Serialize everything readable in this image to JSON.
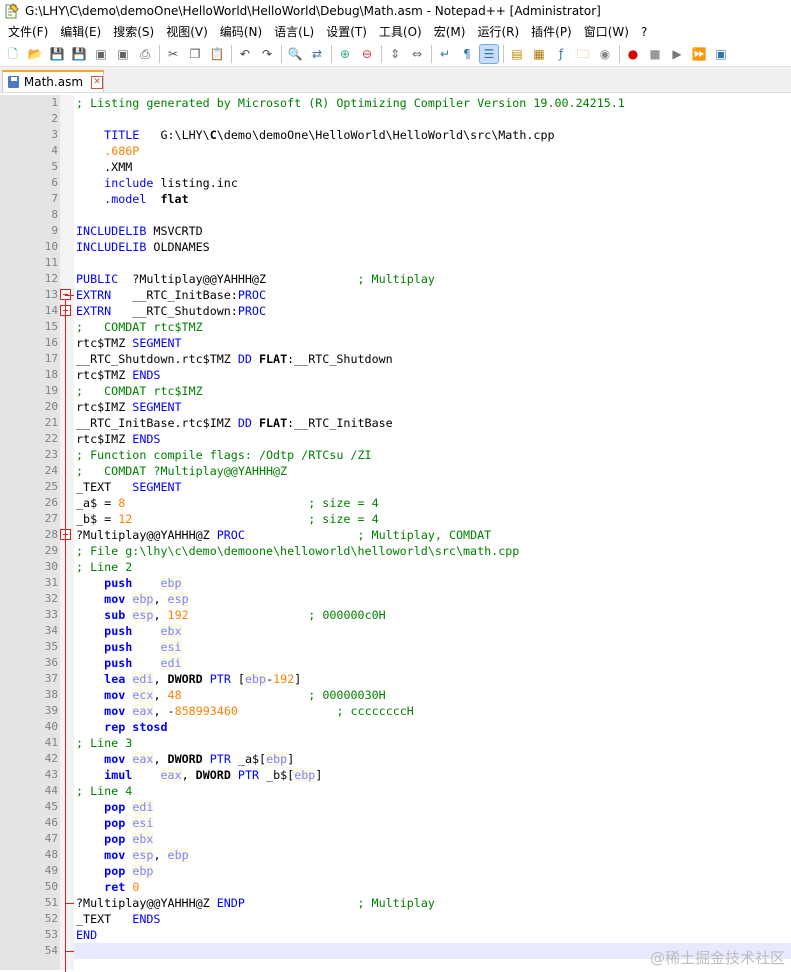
{
  "window": {
    "title": "G:\\LHY\\C\\demo\\demoOne\\HelloWorld\\HelloWorld\\Debug\\Math.asm - Notepad++ [Administrator]"
  },
  "menu": [
    "文件(F)",
    "编辑(E)",
    "搜索(S)",
    "视图(V)",
    "编码(N)",
    "语言(L)",
    "设置(T)",
    "工具(O)",
    "宏(M)",
    "运行(R)",
    "插件(P)",
    "窗口(W)",
    "?"
  ],
  "toolbar_icons": [
    "new-file-icon",
    "open-file-icon",
    "save-icon",
    "save-all-icon",
    "close-icon",
    "close-all-icon",
    "print-icon",
    "|",
    "cut-icon",
    "copy-icon",
    "paste-icon",
    "|",
    "undo-icon",
    "redo-icon",
    "|",
    "find-icon",
    "replace-icon",
    "|",
    "zoom-in-icon",
    "zoom-out-icon",
    "|",
    "sync-v-icon",
    "sync-h-icon",
    "|",
    "word-wrap-icon",
    "show-all-chars-icon",
    "indent-guide-icon",
    "|",
    "udl-icon",
    "doc-map-icon",
    "function-list-icon",
    "folder-as-workspace-icon",
    "monitor-icon",
    "|",
    "record-macro-icon",
    "stop-record-icon",
    "play-macro-icon",
    "run-macro-multiple-icon",
    "save-macro-icon"
  ],
  "tab": {
    "label": "Math.asm"
  },
  "watermark": "@稀土掘金技术社区",
  "current_line": 54,
  "lines": [
    [
      [
        "; Listing generated by Microsoft (R) Optimizing Compiler Version 19.00.24215.1",
        "comment"
      ]
    ],
    [],
    [
      [
        "    ",
        "plain"
      ],
      [
        "TITLE",
        "dir"
      ],
      [
        "   G:\\LHY\\",
        "plain"
      ],
      [
        "C",
        "bold"
      ],
      [
        "\\demo\\demoOne\\HelloWorld\\HelloWorld\\src\\Math.cpp",
        "plain"
      ]
    ],
    [
      [
        "    ",
        "plain"
      ],
      [
        ".686P",
        "num"
      ]
    ],
    [
      [
        "    .XMM",
        "plain"
      ]
    ],
    [
      [
        "    ",
        "plain"
      ],
      [
        "include",
        "dir"
      ],
      [
        " listing.inc",
        "plain"
      ]
    ],
    [
      [
        "    ",
        "plain"
      ],
      [
        ".model",
        "dir"
      ],
      [
        "  ",
        "plain"
      ],
      [
        "flat",
        "bold"
      ]
    ],
    [],
    [
      [
        "INCLUDELIB",
        "dir"
      ],
      [
        " MSVCRTD",
        "plain"
      ]
    ],
    [
      [
        "INCLUDELIB",
        "dir"
      ],
      [
        " OLDNAMES",
        "plain"
      ]
    ],
    [],
    [
      [
        "PUBLIC",
        "dir"
      ],
      [
        "  ?Multiplay@@YAHHH@Z             ",
        "plain"
      ],
      [
        "; Multiplay",
        "comment"
      ]
    ],
    [
      [
        "EXTRN",
        "dir"
      ],
      [
        "   __RTC_InitBase:",
        "plain"
      ],
      [
        "PROC",
        "dir"
      ]
    ],
    [
      [
        "EXTRN",
        "dir"
      ],
      [
        "   __RTC_Shutdown:",
        "plain"
      ],
      [
        "PROC",
        "dir"
      ]
    ],
    [
      [
        ";   COMDAT rtc$TMZ",
        "comment"
      ]
    ],
    [
      [
        "rtc$TMZ ",
        "plain"
      ],
      [
        "SEGMENT",
        "dir"
      ]
    ],
    [
      [
        "__RTC_Shutdown.rtc$TMZ ",
        "plain"
      ],
      [
        "DD",
        "dir"
      ],
      [
        " ",
        "plain"
      ],
      [
        "FLAT",
        "bold"
      ],
      [
        ":__RTC_Shutdown",
        "plain"
      ]
    ],
    [
      [
        "rtc$TMZ ",
        "plain"
      ],
      [
        "ENDS",
        "dir"
      ]
    ],
    [
      [
        ";   COMDAT rtc$IMZ",
        "comment"
      ]
    ],
    [
      [
        "rtc$IMZ ",
        "plain"
      ],
      [
        "SEGMENT",
        "dir"
      ]
    ],
    [
      [
        "__RTC_InitBase.rtc$IMZ ",
        "plain"
      ],
      [
        "DD",
        "dir"
      ],
      [
        " ",
        "plain"
      ],
      [
        "FLAT",
        "bold"
      ],
      [
        ":__RTC_InitBase",
        "plain"
      ]
    ],
    [
      [
        "rtc$IMZ ",
        "plain"
      ],
      [
        "ENDS",
        "dir"
      ]
    ],
    [
      [
        "; Function compile flags: /Odtp /RTCsu /ZI",
        "comment"
      ]
    ],
    [
      [
        ";   COMDAT ?Multiplay@@YAHHH@Z",
        "comment"
      ]
    ],
    [
      [
        "_TEXT   ",
        "plain"
      ],
      [
        "SEGMENT",
        "dir"
      ]
    ],
    [
      [
        "_a$ = ",
        "plain"
      ],
      [
        "8",
        "num"
      ],
      [
        "                          ",
        "plain"
      ],
      [
        "; size = 4",
        "comment"
      ]
    ],
    [
      [
        "_b$ = ",
        "plain"
      ],
      [
        "12",
        "num"
      ],
      [
        "                         ",
        "plain"
      ],
      [
        "; size = 4",
        "comment"
      ]
    ],
    [
      [
        "?Multiplay@@YAHHH@Z ",
        "plain"
      ],
      [
        "PROC",
        "dir"
      ],
      [
        "                ",
        "plain"
      ],
      [
        "; Multiplay, COMDAT",
        "comment"
      ]
    ],
    [
      [
        "; File g:\\lhy\\c\\demo\\demoone\\helloworld\\helloworld\\src\\math.cpp",
        "comment"
      ]
    ],
    [
      [
        "; Line 2",
        "comment"
      ]
    ],
    [
      [
        "    ",
        "plain"
      ],
      [
        "push",
        "instr"
      ],
      [
        "    ",
        "plain"
      ],
      [
        "ebp",
        "reg"
      ]
    ],
    [
      [
        "    ",
        "plain"
      ],
      [
        "mov",
        "instr"
      ],
      [
        " ",
        "plain"
      ],
      [
        "ebp",
        "reg"
      ],
      [
        ", ",
        "plain"
      ],
      [
        "esp",
        "reg"
      ]
    ],
    [
      [
        "    ",
        "plain"
      ],
      [
        "sub",
        "instr"
      ],
      [
        " ",
        "plain"
      ],
      [
        "esp",
        "reg"
      ],
      [
        ", ",
        "plain"
      ],
      [
        "192",
        "num"
      ],
      [
        "                 ",
        "plain"
      ],
      [
        "; 000000c0H",
        "comment"
      ]
    ],
    [
      [
        "    ",
        "plain"
      ],
      [
        "push",
        "instr"
      ],
      [
        "    ",
        "plain"
      ],
      [
        "ebx",
        "reg"
      ]
    ],
    [
      [
        "    ",
        "plain"
      ],
      [
        "push",
        "instr"
      ],
      [
        "    ",
        "plain"
      ],
      [
        "esi",
        "reg"
      ]
    ],
    [
      [
        "    ",
        "plain"
      ],
      [
        "push",
        "instr"
      ],
      [
        "    ",
        "plain"
      ],
      [
        "edi",
        "reg"
      ]
    ],
    [
      [
        "    ",
        "plain"
      ],
      [
        "lea",
        "instr"
      ],
      [
        " ",
        "plain"
      ],
      [
        "edi",
        "reg"
      ],
      [
        ", ",
        "plain"
      ],
      [
        "DWORD",
        "bold"
      ],
      [
        " ",
        "plain"
      ],
      [
        "PTR",
        "ptr"
      ],
      [
        " [",
        "plain"
      ],
      [
        "ebp",
        "reg"
      ],
      [
        "-",
        "plain"
      ],
      [
        "192",
        "num"
      ],
      [
        "]",
        "plain"
      ]
    ],
    [
      [
        "    ",
        "plain"
      ],
      [
        "mov",
        "instr"
      ],
      [
        " ",
        "plain"
      ],
      [
        "ecx",
        "reg"
      ],
      [
        ", ",
        "plain"
      ],
      [
        "48",
        "num"
      ],
      [
        "                  ",
        "plain"
      ],
      [
        "; 00000030H",
        "comment"
      ]
    ],
    [
      [
        "    ",
        "plain"
      ],
      [
        "mov",
        "instr"
      ],
      [
        " ",
        "plain"
      ],
      [
        "eax",
        "reg"
      ],
      [
        ", -",
        "plain"
      ],
      [
        "858993460",
        "num"
      ],
      [
        "              ",
        "plain"
      ],
      [
        "; ccccccccH",
        "comment"
      ]
    ],
    [
      [
        "    ",
        "plain"
      ],
      [
        "rep stosd",
        "instr"
      ]
    ],
    [
      [
        "; Line 3",
        "comment"
      ]
    ],
    [
      [
        "    ",
        "plain"
      ],
      [
        "mov",
        "instr"
      ],
      [
        " ",
        "plain"
      ],
      [
        "eax",
        "reg"
      ],
      [
        ", ",
        "plain"
      ],
      [
        "DWORD",
        "bold"
      ],
      [
        " ",
        "plain"
      ],
      [
        "PTR",
        "ptr"
      ],
      [
        " _a$[",
        "plain"
      ],
      [
        "ebp",
        "reg"
      ],
      [
        "]",
        "plain"
      ]
    ],
    [
      [
        "    ",
        "plain"
      ],
      [
        "imul",
        "instr"
      ],
      [
        "    ",
        "plain"
      ],
      [
        "eax",
        "reg"
      ],
      [
        ", ",
        "plain"
      ],
      [
        "DWORD",
        "bold"
      ],
      [
        " ",
        "plain"
      ],
      [
        "PTR",
        "ptr"
      ],
      [
        " _b$[",
        "plain"
      ],
      [
        "ebp",
        "reg"
      ],
      [
        "]",
        "plain"
      ]
    ],
    [
      [
        "; Line 4",
        "comment"
      ]
    ],
    [
      [
        "    ",
        "plain"
      ],
      [
        "pop",
        "instr"
      ],
      [
        " ",
        "plain"
      ],
      [
        "edi",
        "reg"
      ]
    ],
    [
      [
        "    ",
        "plain"
      ],
      [
        "pop",
        "instr"
      ],
      [
        " ",
        "plain"
      ],
      [
        "esi",
        "reg"
      ]
    ],
    [
      [
        "    ",
        "plain"
      ],
      [
        "pop",
        "instr"
      ],
      [
        " ",
        "plain"
      ],
      [
        "ebx",
        "reg"
      ]
    ],
    [
      [
        "    ",
        "plain"
      ],
      [
        "mov",
        "instr"
      ],
      [
        " ",
        "plain"
      ],
      [
        "esp",
        "reg"
      ],
      [
        ", ",
        "plain"
      ],
      [
        "ebp",
        "reg"
      ]
    ],
    [
      [
        "    ",
        "plain"
      ],
      [
        "pop",
        "instr"
      ],
      [
        " ",
        "plain"
      ],
      [
        "ebp",
        "reg"
      ]
    ],
    [
      [
        "    ",
        "plain"
      ],
      [
        "ret",
        "instr"
      ],
      [
        " ",
        "plain"
      ],
      [
        "0",
        "num"
      ]
    ],
    [
      [
        "?Multiplay@@YAHHH@Z ",
        "plain"
      ],
      [
        "ENDP",
        "dir"
      ],
      [
        "                ",
        "plain"
      ],
      [
        "; Multiplay",
        "comment"
      ]
    ],
    [
      [
        "_TEXT   ",
        "plain"
      ],
      [
        "ENDS",
        "dir"
      ]
    ],
    [
      [
        "END",
        "dir"
      ]
    ],
    []
  ]
}
